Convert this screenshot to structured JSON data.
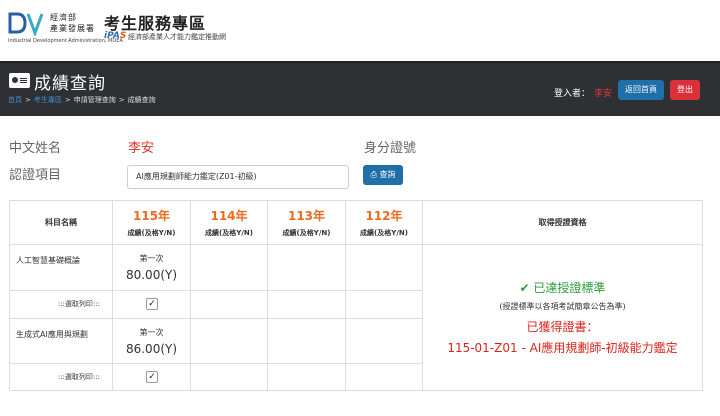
{
  "header": {
    "org_line1": "經濟部",
    "org_line2": "產業發展署",
    "org_en": "Industrial Development Administration, MOEA",
    "zone_title": "考生服務專區",
    "ipas_logo_a": "iPA",
    "ipas_logo_b": "S",
    "ipas_sub": "經濟部產業人才能力鑑定推動網"
  },
  "titlebar": {
    "page_title": "成績查詢",
    "breadcrumb": [
      "首頁",
      "考生專區",
      "申請管理查詢",
      "成績查詢"
    ],
    "login_label": "登入者：",
    "login_user": "李安",
    "home_button": "返回首頁",
    "logout_button": "登出"
  },
  "form": {
    "name_label": "中文姓名",
    "name_value": "李安",
    "id_label": "身分證號",
    "cert_label": "認證項目",
    "cert_value": "AI應用規劃師能力鑑定(Z01-初級)",
    "query_button": "查詢"
  },
  "table": {
    "col_subject": "科目名稱",
    "years": [
      "115年",
      "114年",
      "113年",
      "112年"
    ],
    "year_sub": "成績(及格Y/N)",
    "col_result": "取得授證資格",
    "rows": [
      {
        "subject": "人工智慧基礎概論",
        "attempt": "第一次",
        "score": "80.00(Y)"
      },
      {
        "subject": "生成式AI應用與規劃",
        "attempt": "第一次",
        "score": "86.00(Y)"
      }
    ],
    "print_label": ":::選取列印:::",
    "print_checked": true,
    "result_ok": "已達授證標準",
    "result_note": "(授證標準以各項考試簡章公告為準)",
    "result_cert": "已獲得證書：",
    "result_certname": "115-01-Z01 - AI應用規劃師-初級能力鑑定"
  },
  "colors": {
    "dark_bar": "#2f3033",
    "primary_button": "#1f6fa8",
    "danger_button": "#d9303a",
    "year_orange": "#f06a1d",
    "success_green": "#2e9d3f",
    "cert_red": "#d9251d"
  }
}
